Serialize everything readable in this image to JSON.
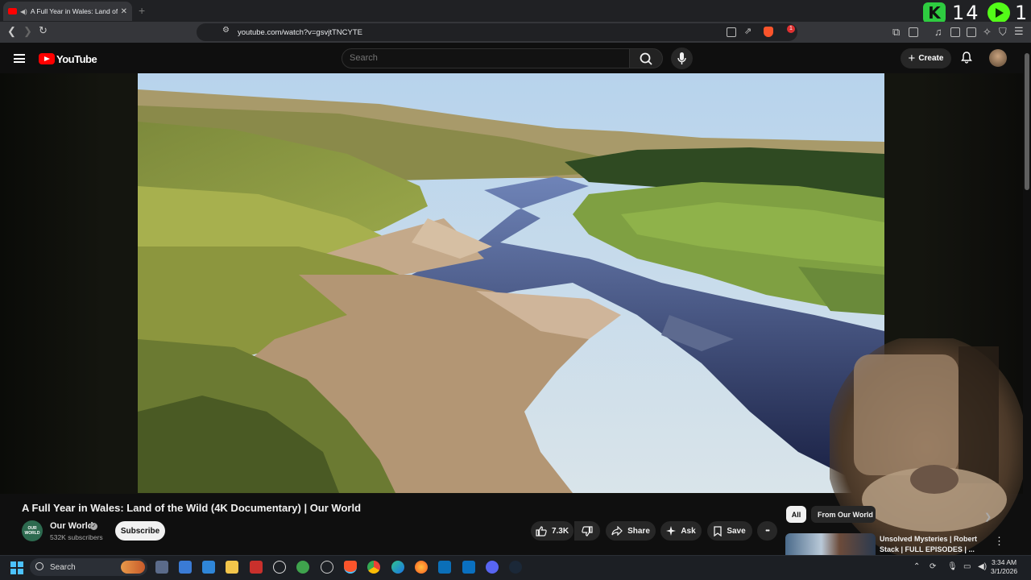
{
  "browser": {
    "tab_title": "A Full Year in Wales: Land of t",
    "new_tab": "+",
    "url": "youtube.com/watch?v=gsvjtTNCYTE",
    "shield_badge": "1"
  },
  "overlay": {
    "left_count": "14",
    "right_count": "1"
  },
  "masthead": {
    "logo_text": "YouTube",
    "search_placeholder": "Search",
    "create_label": "Create"
  },
  "video": {
    "title": "A Full Year in Wales: Land of the Wild (4K Documentary) | Our World",
    "channel_name": "Our World",
    "channel_avatar_text": "OUR WORLD",
    "subscribers": "532K subscribers",
    "subscribe_label": "Subscribe",
    "likes": "7.3K",
    "share_label": "Share",
    "ask_label": "Ask",
    "save_label": "Save",
    "more_label": "•••"
  },
  "sidebar": {
    "chips": [
      "All",
      "From Our World"
    ],
    "recommendation_title": "Unsolved Mysteries | Robert Stack | FULL EPISODES | ..."
  },
  "taskbar": {
    "search_label": "Search",
    "time": "3:34 AM",
    "date": "3/1/2026"
  },
  "colors": {
    "youtube_red": "#ff0000",
    "kick_green": "#53fc18",
    "background": "#0f0f0f"
  }
}
